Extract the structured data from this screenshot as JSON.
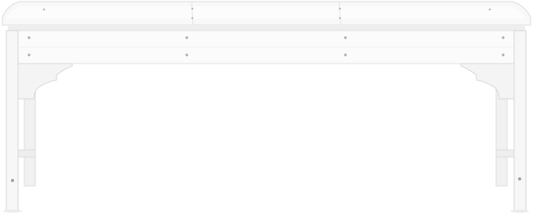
{
  "image": {
    "subject": "white-bench-product-photo",
    "colors": {
      "background": "#ffffff",
      "body": "#f7f7f7",
      "face": "#fbfbfb",
      "shade": "#e6e6e6",
      "edge": "#d2d2d2",
      "screw": "#a9a9a9"
    }
  }
}
